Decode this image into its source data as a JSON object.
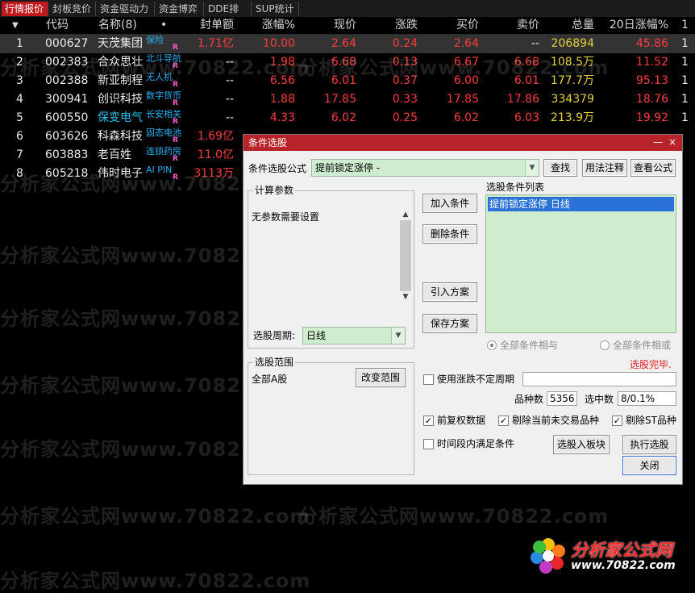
{
  "tabs": [
    "行情报价",
    "封板竞价",
    "资金驱动力",
    "资金博弈",
    "DDE排名",
    "SUP统计"
  ],
  "table": {
    "headers": {
      "marker": "▼",
      "code": "代码",
      "name": "名称(8)",
      "dot": "•",
      "seal": "封单额",
      "pct": "涨幅%",
      "price": "现价",
      "chg": "涨跌",
      "bid": "买价",
      "ask": "卖价",
      "vol": "总量",
      "pct20": "20日涨幅%",
      "extra": "1"
    },
    "rows": [
      {
        "idx": "1",
        "code": "000627",
        "name": "天茂集团",
        "tag": "保险",
        "r": "R",
        "seal": "1.71亿",
        "pct": "10.00",
        "price": "2.64",
        "chg": "0.24",
        "bid": "2.64",
        "ask": "--",
        "vol": "206894",
        "pct20": "45.86",
        "extra": "1"
      },
      {
        "idx": "2",
        "code": "002383",
        "name": "合众思壮",
        "tag": "北斗导航",
        "r": "R",
        "seal": "--",
        "pct": "1.98",
        "price": "6.68",
        "chg": "0.13",
        "bid": "6.67",
        "ask": "6.68",
        "vol": "108.5万",
        "pct20": "11.52",
        "extra": "1"
      },
      {
        "idx": "3",
        "code": "002388",
        "name": "新亚制程",
        "tag": "无人机",
        "r": "R",
        "seal": "--",
        "pct": "6.56",
        "price": "6.01",
        "chg": "0.37",
        "bid": "6.00",
        "ask": "6.01",
        "vol": "177.7万",
        "pct20": "95.13",
        "extra": "1"
      },
      {
        "idx": "4",
        "code": "300941",
        "name": "创识科技",
        "tag": "数字货币",
        "r": "R",
        "seal": "--",
        "pct": "1.88",
        "price": "17.85",
        "chg": "0.33",
        "bid": "17.85",
        "ask": "17.86",
        "vol": "334379",
        "pct20": "18.76",
        "extra": "1"
      },
      {
        "idx": "5",
        "code": "600550",
        "name": "保变电气",
        "tag": "长安相关",
        "r": "R",
        "seal": "--",
        "pct": "4.33",
        "price": "6.02",
        "chg": "0.25",
        "bid": "6.02",
        "ask": "6.03",
        "vol": "213.9万",
        "pct20": "19.92",
        "extra": "1"
      },
      {
        "idx": "6",
        "code": "603626",
        "name": "科森科技",
        "tag": "固态电池",
        "r": "R",
        "seal": "1.69亿",
        "pct": "",
        "price": "",
        "chg": "",
        "bid": "",
        "ask": "",
        "vol": "",
        "pct20": "",
        "extra": ""
      },
      {
        "idx": "7",
        "code": "603883",
        "name": "老百姓",
        "tag": "连锁药房",
        "r": "R",
        "seal": "11.0亿",
        "pct": "",
        "price": "",
        "chg": "",
        "bid": "",
        "ask": "",
        "vol": "",
        "pct20": "",
        "extra": ""
      },
      {
        "idx": "8",
        "code": "605218",
        "name": "伟时电子",
        "tag": "AI PIN",
        "r": "R",
        "seal": "3113万",
        "pct": "",
        "price": "",
        "chg": "",
        "bid": "",
        "ask": "",
        "vol": "",
        "pct20": "",
        "extra": ""
      }
    ]
  },
  "watermark": "分析家公式网www.70822.com",
  "dialog": {
    "title": "条件选股",
    "min": "—",
    "close": "×",
    "formula_label": "条件选股公式",
    "formula_value": "提前锁定涨停  -",
    "btn_find": "查找",
    "btn_usage": "用法注释",
    "btn_view": "查看公式",
    "calc_group": "计算参数",
    "calc_text": "无参数需要设置",
    "period_label": "选股周期:",
    "period_value": "日线",
    "btn_add": "加入条件",
    "btn_delete": "删除条件",
    "btn_import": "引入方案",
    "btn_save": "保存方案",
    "list_label": "选股条件列表",
    "list_items": [
      "提前锁定涨停  日线"
    ],
    "radio_and": "全部条件相与",
    "radio_or": "全部条件相或",
    "status": "选股完毕.",
    "range_group": "选股范围",
    "range_value": "全部A股",
    "btn_change_range": "改变范围",
    "chk_uncertain": "使用涨跌不定周期",
    "count_label": "品种数",
    "count_value": "5356",
    "selected_label": "选中数",
    "selected_value": "8/0.1%",
    "chk_forward": "前复权数据",
    "chk_remove_untraded": "剔除当前未交易品种",
    "chk_remove_st": "剔除ST品种",
    "chk_time_range": "时间段内满足条件",
    "btn_to_board": "选股入板块",
    "btn_execute": "执行选股",
    "btn_close": "关闭",
    "check_mark": "✓"
  },
  "logo": {
    "title": "分析家公式网",
    "url": "www.70822.com"
  }
}
